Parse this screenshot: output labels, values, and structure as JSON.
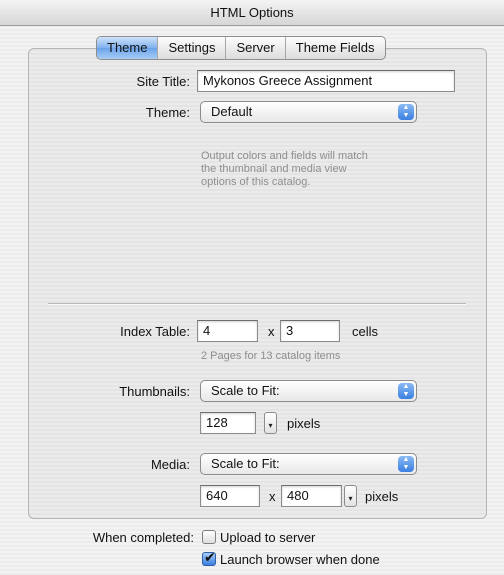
{
  "window": {
    "title": "HTML Options"
  },
  "tabs": [
    {
      "label": "Theme",
      "active": true
    },
    {
      "label": "Settings",
      "active": false
    },
    {
      "label": "Server",
      "active": false
    },
    {
      "label": "Theme Fields",
      "active": false
    }
  ],
  "theme_section": {
    "site_title_label": "Site Title:",
    "site_title_value": "Mykonos Greece Assignment",
    "theme_label": "Theme:",
    "theme_value": "Default",
    "description": "Output colors and fields will match the thumbnail and media view options of this catalog."
  },
  "index_table": {
    "label": "Index Table:",
    "cols": "4",
    "x_label": "x",
    "rows": "3",
    "unit": "cells",
    "info": "2 Pages for 13 catalog items"
  },
  "thumbnails": {
    "label": "Thumbnails:",
    "mode": "Scale to Fit:",
    "size": "128",
    "unit": "pixels"
  },
  "media": {
    "label": "Media:",
    "mode": "Scale to Fit:",
    "width": "640",
    "x_label": "x",
    "height": "480",
    "unit": "pixels"
  },
  "completion": {
    "label": "When completed:",
    "upload_label": "Upload to server",
    "upload_checked": false,
    "launch_label": "Launch browser when done",
    "launch_checked": true
  },
  "colors": {
    "accent": "#3a7fe0",
    "hint_text": "#8e8e8e"
  },
  "icons": {
    "popup": "up-down-arrows-icon",
    "stepper": "stepper-icon",
    "check": "checkmark-icon"
  }
}
